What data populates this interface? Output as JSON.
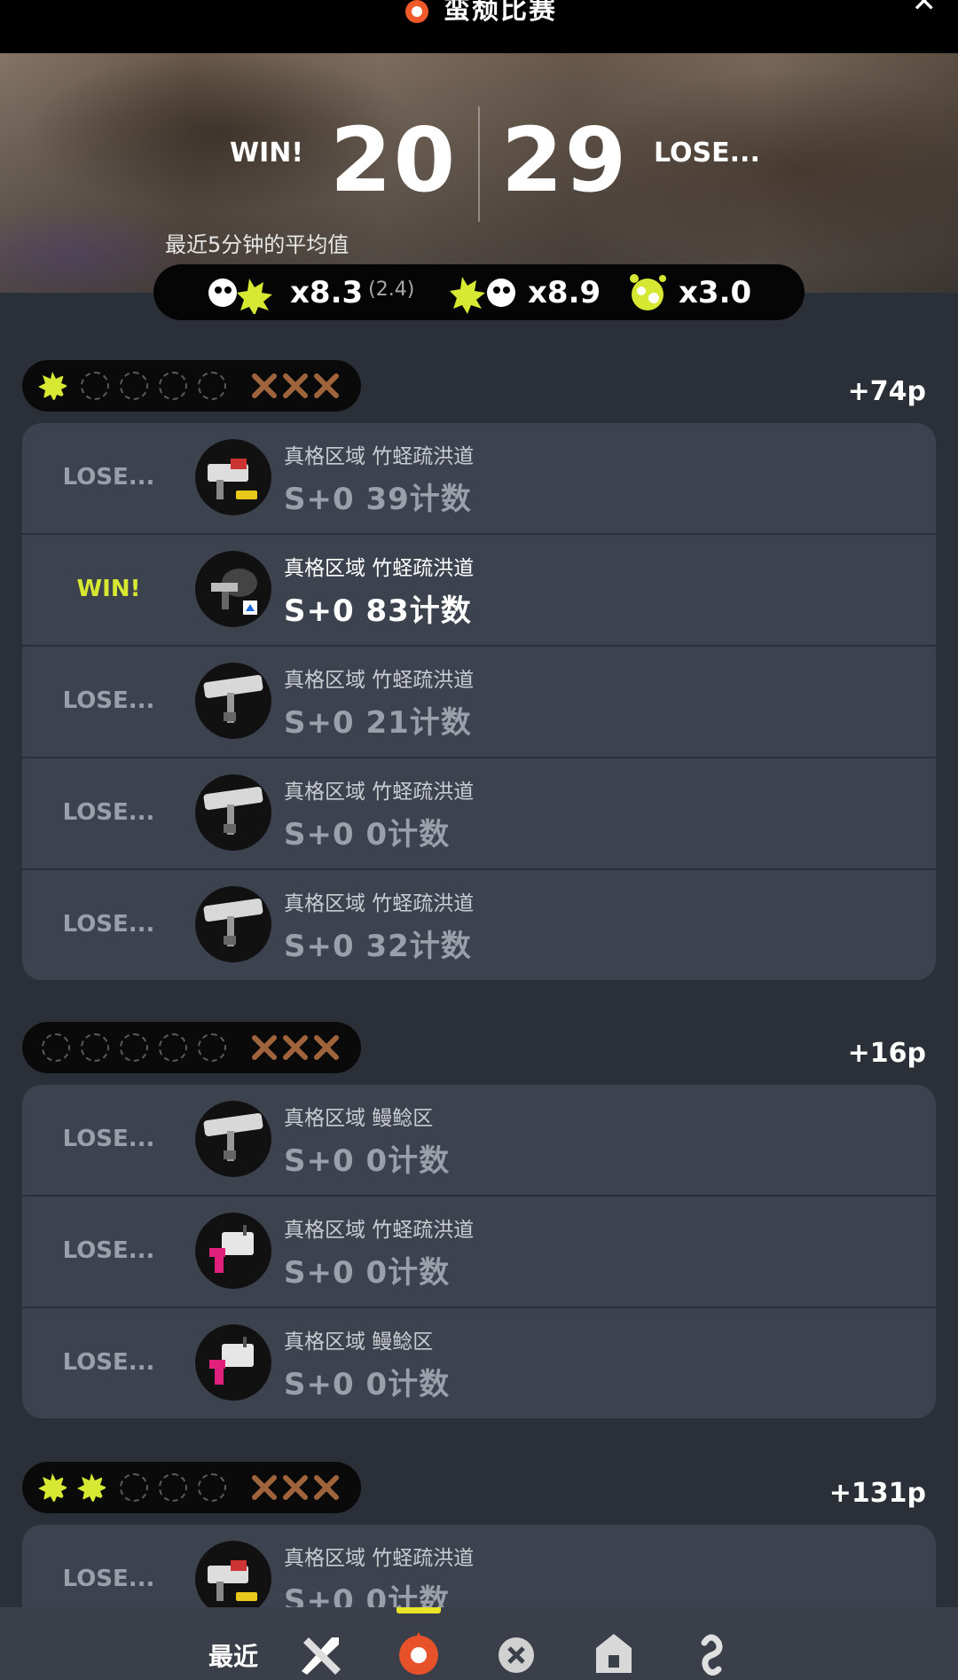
{
  "header": {
    "title": "蛮颓比赛"
  },
  "hero": {
    "win_label": "WIN!",
    "score_left": "20",
    "score_right": "29",
    "lose_label": "LOSE...",
    "avg_label": "最近5分钟的平均值"
  },
  "stats": {
    "kills": "x8.3",
    "kills_assist": "(2.4)",
    "deaths": "x8.9",
    "specials": "x3.0"
  },
  "sections": [
    {
      "points": "+74p",
      "wins_filled": 1,
      "rows": [
        {
          "result": "LOSE...",
          "mode": "真格区域 竹蛏疏洪道",
          "score": "S+0 39计数",
          "weapon": "splattershot-pro-icon"
        },
        {
          "result": "WIN!",
          "mode": "真格区域 竹蛏疏洪道",
          "score": "S+0 83计数",
          "weapon": "sploosh-icon"
        },
        {
          "result": "LOSE...",
          "mode": "真格区域 竹蛏疏洪道",
          "score": "S+0 21计数",
          "weapon": "roller-icon"
        },
        {
          "result": "LOSE...",
          "mode": "真格区域 竹蛏疏洪道",
          "score": "S+0 0计数",
          "weapon": "roller-icon"
        },
        {
          "result": "LOSE...",
          "mode": "真格区域 竹蛏疏洪道",
          "score": "S+0 32计数",
          "weapon": "roller-icon"
        }
      ]
    },
    {
      "points": "+16p",
      "wins_filled": 0,
      "rows": [
        {
          "result": "LOSE...",
          "mode": "真格区域 鳗鲶区",
          "score": "S+0 0计数",
          "weapon": "roller-icon"
        },
        {
          "result": "LOSE...",
          "mode": "真格区域 竹蛏疏洪道",
          "score": "S+0 0计数",
          "weapon": "pink-blaster-icon"
        },
        {
          "result": "LOSE...",
          "mode": "真格区域 鳗鲶区",
          "score": "S+0 0计数",
          "weapon": "pink-blaster-icon"
        }
      ]
    },
    {
      "points": "+131p",
      "wins_filled": 2,
      "rows": [
        {
          "result": "LOSE...",
          "mode": "真格区域 竹蛏疏洪道",
          "score": "S+0 0计数",
          "weapon": "splattershot-pro-icon"
        }
      ]
    }
  ],
  "nav": {
    "label": "最近",
    "active_tab": 1
  },
  "colors": {
    "accent": "#d6e832",
    "panel": "#3d434e",
    "background": "#2b2f37"
  }
}
